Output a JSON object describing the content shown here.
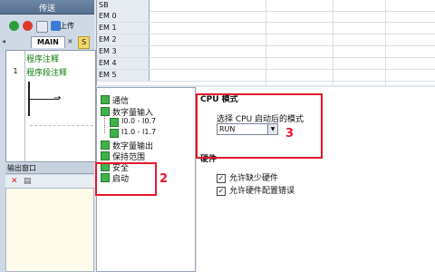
{
  "left": {
    "transfer_label": "传送",
    "toolbar": {
      "upload_label": "上传"
    },
    "tabs": {
      "main": "MAIN",
      "second": "S"
    },
    "editor": {
      "program_comment": "程序注释",
      "network_number": "1",
      "network_comment": "程序段注释"
    },
    "output_window": {
      "title": "输出窗口"
    }
  },
  "table": {
    "rows": [
      "SB",
      "EM 0",
      "EM 1",
      "EM 2",
      "EM 3",
      "EM 4",
      "EM 5"
    ]
  },
  "tree": {
    "items": [
      "通信",
      "数字量输入",
      "I0.0 - I0.7",
      "I1.0 - I1.7",
      "数字量输出",
      "保持范围",
      "安全",
      "启动"
    ]
  },
  "panel": {
    "cpu_mode_heading": "CPU 模式",
    "mode_label": "选择 CPU 启动后的模式",
    "mode_value": "RUN",
    "hardware_heading": "硬件",
    "allow_missing": "允许缺少硬件",
    "allow_config_error": "允许硬件配置错误"
  },
  "annotations": {
    "n2": "2",
    "n3": "3"
  },
  "colors": {
    "accent_red": "#e8162b",
    "tree_green": "#3fb24a"
  }
}
